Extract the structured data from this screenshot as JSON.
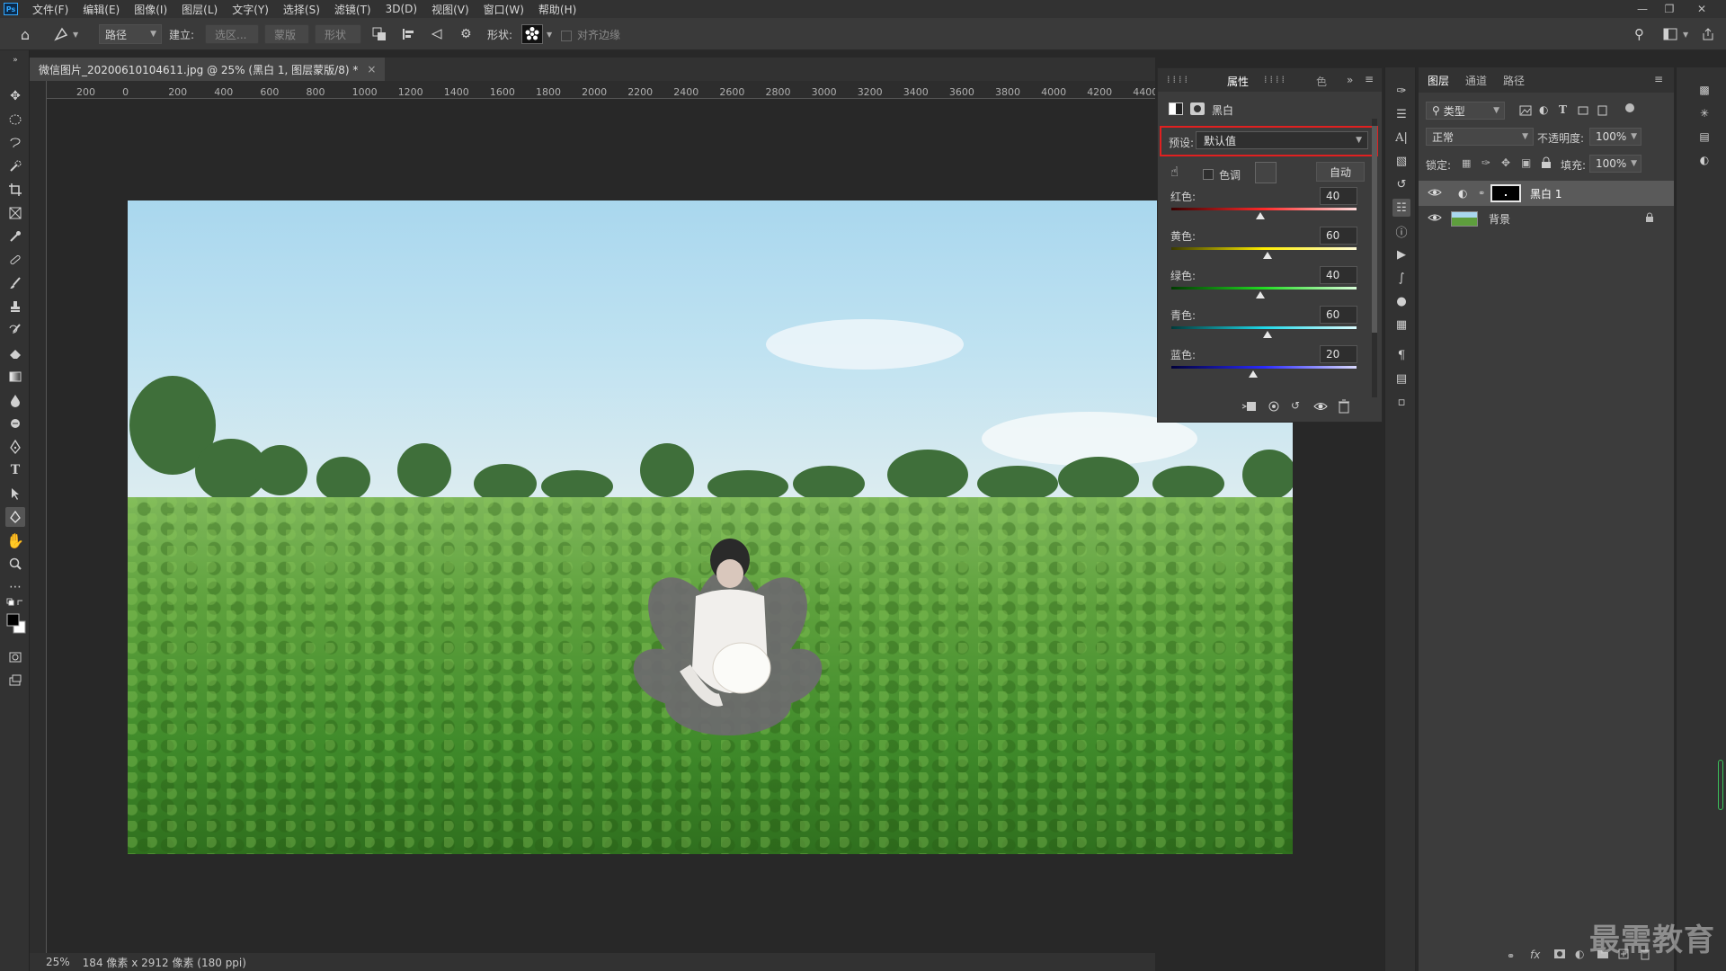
{
  "menubar": {
    "app_icon": "Ps",
    "items": [
      "文件(F)",
      "编辑(E)",
      "图像(I)",
      "图层(L)",
      "文字(Y)",
      "选择(S)",
      "滤镜(T)",
      "3D(D)",
      "视图(V)",
      "窗口(W)",
      "帮助(H)"
    ]
  },
  "options": {
    "mode_value": "路径",
    "build_label": "建立:",
    "btn_selection": "选区...",
    "btn_mask": "蒙版",
    "btn_shape": "形状",
    "shape_label": "形状:",
    "align_edges_label": "对齐边缘"
  },
  "document": {
    "tab_title": "微信图片_20200610104611.jpg @ 25% (黑白 1, 图层蒙版/8) *",
    "tab_close": "×",
    "ruler_ticks": [
      "200",
      "0",
      "200",
      "400",
      "600",
      "800",
      "1000",
      "1200",
      "1400",
      "1600",
      "1800",
      "2000",
      "2200",
      "2400",
      "2600",
      "2800",
      "3000",
      "3200",
      "3400",
      "3600",
      "3800",
      "4000",
      "4200",
      "4400"
    ],
    "zoom": "25%",
    "size_info": "184 像素 x 2912 像素 (180 ppi)"
  },
  "properties": {
    "tab_label": "属性",
    "tab_more": "色",
    "adjustment_name": "黑白",
    "preset_label": "预设:",
    "preset_value": "默认值",
    "tint_label": "色调",
    "auto_button": "自动",
    "sliders": [
      {
        "label": "红色:",
        "value": "40"
      },
      {
        "label": "黄色:",
        "value": "60"
      },
      {
        "label": "绿色:",
        "value": "40"
      },
      {
        "label": "青色:",
        "value": "60"
      },
      {
        "label": "蓝色:",
        "value": "20"
      }
    ],
    "highlight_color": "#e02020"
  },
  "layers_panel": {
    "tabs": [
      "图层",
      "通道",
      "路径"
    ],
    "filter_value": "类型",
    "blend_mode": "正常",
    "opacity_label": "不透明度:",
    "opacity_value": "100%",
    "lock_label": "锁定:",
    "fill_label": "填充:",
    "fill_value": "100%",
    "layers": [
      {
        "name": "黑白 1"
      },
      {
        "name": "背景"
      }
    ]
  },
  "watermark": "最需教育"
}
